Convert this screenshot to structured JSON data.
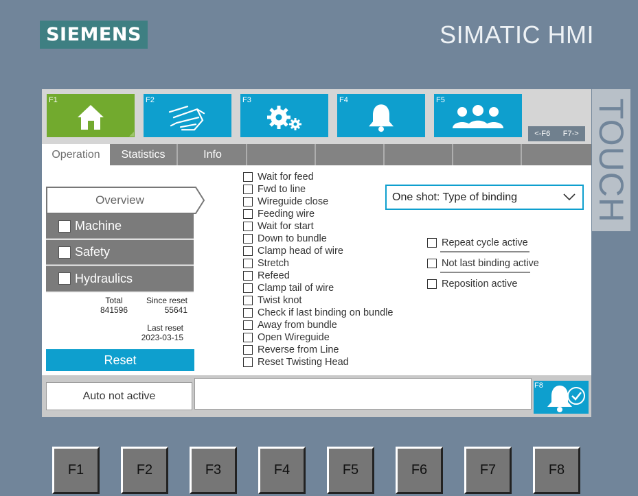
{
  "brand": {
    "logo": "SIEMENS",
    "product": "SIMATIC HMI",
    "side_label": "TOUCH"
  },
  "function_keys": [
    {
      "label": "F1",
      "icon": "home-icon",
      "active": true
    },
    {
      "label": "F2",
      "icon": "hand-icon",
      "active": false
    },
    {
      "label": "F3",
      "icon": "gears-icon",
      "active": false
    },
    {
      "label": "F4",
      "icon": "bell-icon",
      "active": false
    },
    {
      "label": "F5",
      "icon": "users-icon",
      "active": false
    }
  ],
  "page_nav": {
    "prev": "<-F6",
    "next": "F7->"
  },
  "tabs": [
    "Operation",
    "Statistics",
    "Info",
    "",
    "",
    "",
    "",
    ""
  ],
  "sidebar": {
    "overview": "Overview",
    "items": [
      "Machine",
      "Safety",
      "Hydraulics"
    ]
  },
  "counters": {
    "total_label": "Total",
    "total_value": "841596",
    "since_reset_label": "Since reset",
    "since_reset_value": "55641",
    "last_reset_label": "Last reset",
    "last_reset_value": "2023-03-15"
  },
  "reset_button": "Reset",
  "steps": [
    "Wait for feed",
    "Fwd to  line",
    "Wireguide close",
    "Feeding wire",
    "Wait for start",
    "Down to bundle",
    "Clamp head of wire",
    "Stretch",
    "Refeed",
    "Clamp tail of wire",
    "Twist knot",
    "Check if last binding on bundle",
    "Away from bundle",
    "Open Wireguide",
    "Reverse from Line",
    "Reset Twisting Head"
  ],
  "binding_dropdown": {
    "value": "One shot: Type of binding"
  },
  "options": [
    "Repeat cycle active",
    "Not last binding active",
    "Reposition active"
  ],
  "status": {
    "auto": "Auto not active",
    "message": ""
  },
  "ack_key": {
    "label": "F8",
    "icon": "alarm-acknowledge-icon"
  },
  "hardware_keys": [
    "F1",
    "F2",
    "F3",
    "F4",
    "F5",
    "F6",
    "F7",
    "F8"
  ],
  "colors": {
    "accent": "#0e9fce",
    "active": "#72aa2e",
    "bezel": "#71859a",
    "tabbar": "#838383"
  }
}
